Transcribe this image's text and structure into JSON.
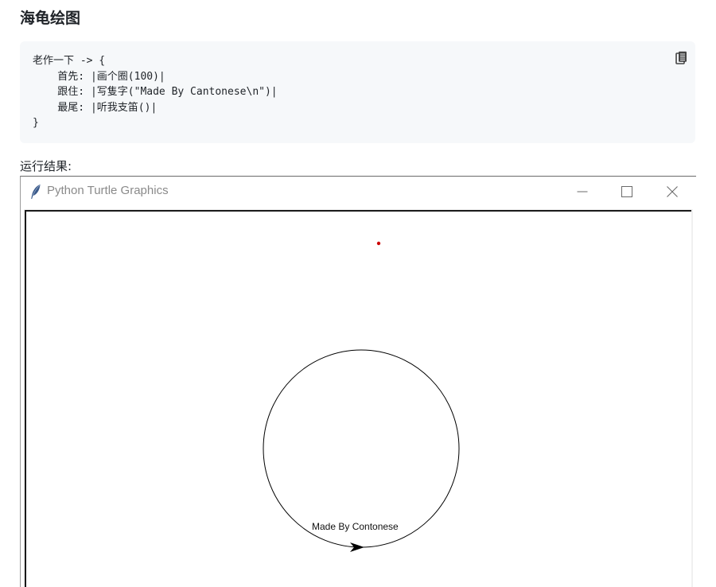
{
  "page": {
    "heading": "海龟绘图",
    "result_label": "运行结果:"
  },
  "code": {
    "lines": [
      "老作一下 -> {",
      "    首先: |画个圈(100)|",
      "    跟住: |写隻字(\"Made By Cantonese\\n\")|",
      "    最尾: |听我支笛()|",
      "}"
    ],
    "copy_icon": "copy-icon"
  },
  "turtle_window": {
    "title": "Python Turtle Graphics",
    "app_icon": "feather-icon",
    "controls": {
      "minimize_icon": "minimize-icon",
      "maximize_icon": "maximize-icon",
      "close_icon": "close-icon"
    },
    "canvas": {
      "written_text": "Made By Contonese",
      "drawing": "circle",
      "circle_radius": 100,
      "pen_color": "#000000",
      "dot_color": "#cc0000",
      "turtle_shape": "arrow"
    }
  },
  "colors": {
    "code_background": "#f6f8fa",
    "text": "#1f2328",
    "title_text": "#8a8a8a"
  }
}
